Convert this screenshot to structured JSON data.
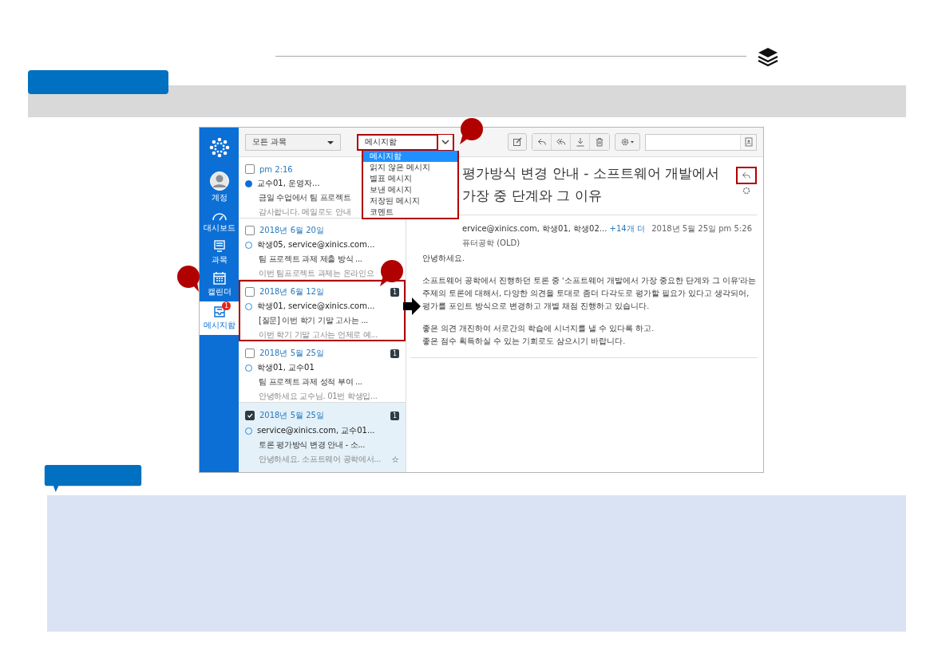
{
  "screenshot": {
    "sidebar": {
      "items": [
        {
          "kind": "avatar",
          "label": "계정",
          "selected": false
        },
        {
          "kind": "dashboard",
          "label": "대시보드",
          "selected": false
        },
        {
          "kind": "courses",
          "label": "과목",
          "selected": false
        },
        {
          "kind": "calendar",
          "label": "캘린더",
          "selected": false
        },
        {
          "kind": "inbox",
          "label": "메시지함",
          "selected": true,
          "badge": "1"
        }
      ]
    },
    "toolbar": {
      "course_filter": "모든 과목",
      "mailbox_filter": "메시지함",
      "mailbox_highlighted": true
    },
    "mailbox_menu": {
      "options": [
        {
          "label": "메시지함",
          "selected": true
        },
        {
          "label": "읽지 않은 메시지",
          "selected": false
        },
        {
          "label": "별표 메시지",
          "selected": false
        },
        {
          "label": "보낸 메시지",
          "selected": false
        },
        {
          "label": "저장된 메시지",
          "selected": false
        },
        {
          "label": "코멘트",
          "selected": false
        }
      ]
    },
    "messages": [
      {
        "date": "pm 2:16",
        "participants": "교수01, 운영자...",
        "subject": "금일 수업에서 팀 프로젝트",
        "preview": "감사합니다. 메일로도 안내",
        "unread": true,
        "checked": false,
        "selected": false,
        "highlighted": false
      },
      {
        "date": "2018년 6월 20일",
        "participants": "학생05, service@xinics.com...",
        "subject": "팀 프로젝트 과제 제출 방식 ...",
        "preview": "이번 팀프로젝트 과제는 온라인으",
        "unread": false,
        "checked": false,
        "selected": false,
        "highlighted": false
      },
      {
        "date": "2018년 6월 12일",
        "participants": "학생01, service@xinics.com...",
        "subject": "[질문] 이번 학기 기말 고사는 ...",
        "preview": "이번 학기 기말 고사는 언제로 예...",
        "unread": false,
        "checked": false,
        "selected": false,
        "highlighted": true,
        "count": "1"
      },
      {
        "date": "2018년 5월 25일",
        "participants": "학생01, 교수01",
        "subject": "팀 프로젝트 과제 성적 부여 ...",
        "preview": "안녕하세요 교수님. 01번 학생입...",
        "unread": false,
        "checked": false,
        "selected": false,
        "highlighted": false,
        "count": "1"
      },
      {
        "date": "2018년 5월 25일",
        "participants": "service@xinics.com, 교수01...",
        "subject": "토론 평가방식 변경 안내 - 소...",
        "preview": "안녕하세요. 소프트웨어 공학에서...",
        "unread": false,
        "checked": true,
        "selected": true,
        "highlighted": false,
        "count": "1",
        "star": "☆"
      }
    ],
    "reader": {
      "title": "평가방식 변경 안내 - 소프트웨어 개발에서 가장 중 단계와 그 이유",
      "sender": "ervice@xinics.com, 학생01, 학생02...",
      "more_link": "+14개 더",
      "course": "퓨터공학 (OLD)",
      "date": "2018년 5월 25일 pm 5:26",
      "body": [
        "안녕하세요.",
        "소프트웨어 공학에서 진행하던 토론 중 '소프트웨어 개발에서 가장 중요한 단계와 그 이유'라는 주제의 토론에 대해서, 다양한 의견을 토대로 좀더 다각도로 평가할 필요가 있다고 생각되어, 평가를 포인트 방식으로 변경하고 개별 채점 진행하고 있습니다.",
        "좋은 의견 개진하여 서로간의 학습에 시너지를 낼 수 있다록 하고.\n좋은 점수 획득하실 수 있는 기회로도 삼으시기 바랍니다."
      ]
    }
  }
}
